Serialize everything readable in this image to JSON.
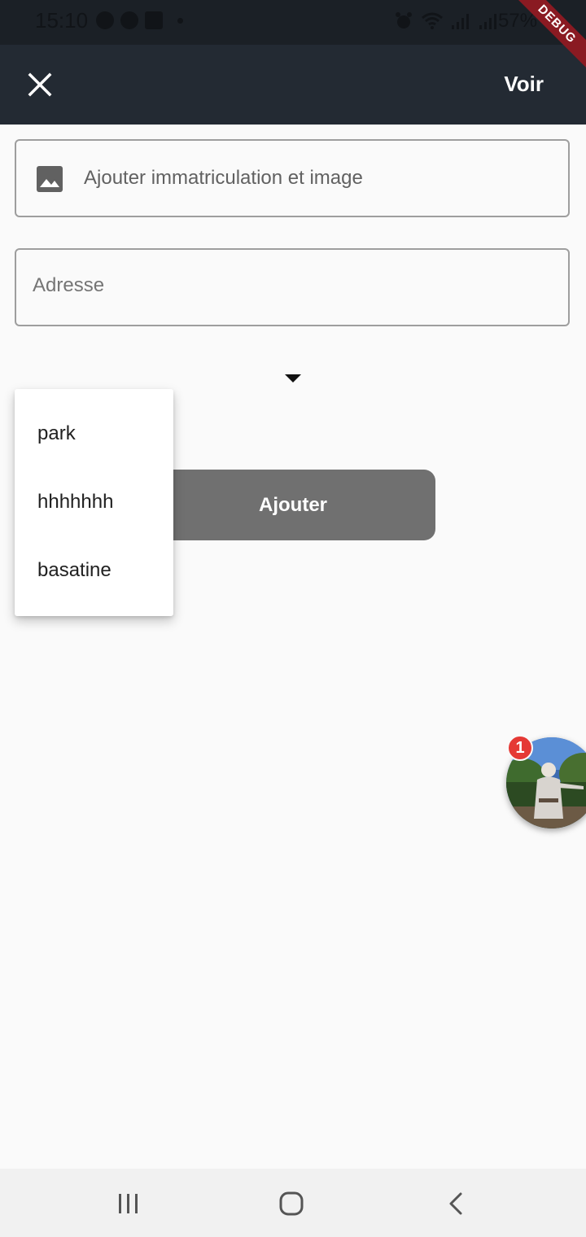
{
  "status_bar": {
    "time": "15:10",
    "battery_text": "57%",
    "icons_left": [
      "messenger-icon",
      "messenger-icon",
      "facebook-icon",
      "dot-icon"
    ],
    "icons_right": [
      "alarm-icon",
      "wifi-icon",
      "signal-icon",
      "signal-icon"
    ]
  },
  "debug_banner": "DEBUG",
  "app_bar": {
    "close_icon": "close-icon",
    "action_label": "Voir"
  },
  "form": {
    "immat_field": {
      "icon": "image-icon",
      "label": "Ajouter immatriculation et image"
    },
    "address_field": {
      "placeholder": "Adresse"
    },
    "dropdown": {
      "icon": "arrow-drop-down-icon",
      "options": [
        "park",
        "hhhhhhh",
        "basatine"
      ]
    },
    "submit_label": "Ajouter"
  },
  "chat_head": {
    "badge_count": "1"
  },
  "colors": {
    "app_bar": "#232a33",
    "status_bar": "#1b2026",
    "button": "#707070",
    "background": "#fafafa",
    "badge": "#e53935"
  }
}
